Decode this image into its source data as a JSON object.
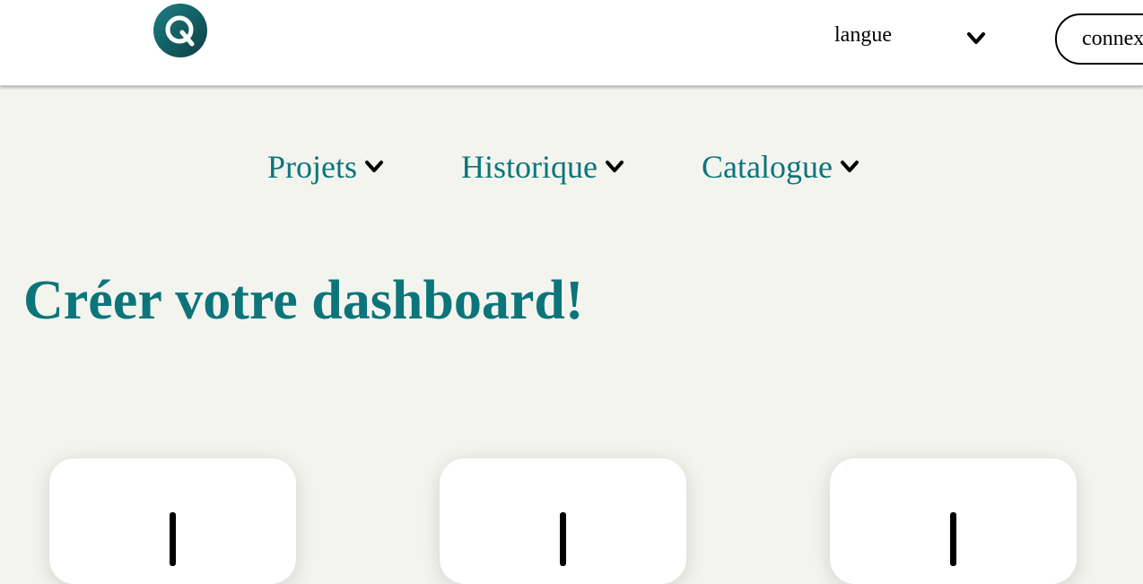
{
  "header": {
    "logo_icon": "q-logo-icon",
    "language_label": "langue",
    "language_chevron_icon": "chevron-down-icon",
    "connect_label": "connexion"
  },
  "nav": {
    "items": [
      {
        "label": "Projets",
        "icon": "chevron-down-icon"
      },
      {
        "label": "Historique",
        "icon": "chevron-down-icon"
      },
      {
        "label": "Catalogue",
        "icon": "chevron-down-icon"
      }
    ]
  },
  "main": {
    "title": "Créer votre dashboard!",
    "cards": [
      {
        "icon": "plus-icon"
      },
      {
        "icon": "plus-icon"
      },
      {
        "icon": "plus-icon"
      }
    ]
  },
  "colors": {
    "accent": "#0b757a",
    "background": "#f4f4ef",
    "logo_dark": "#0d4d52",
    "logo_light": "#1b7f84"
  }
}
